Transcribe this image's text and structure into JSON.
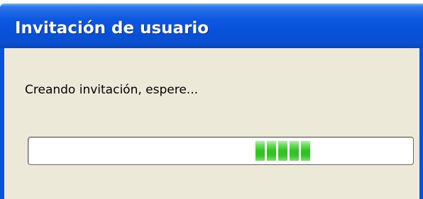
{
  "dialog": {
    "title": "Invitación de usuario",
    "message": "Creando invitación, espere...",
    "progress": {
      "type": "marquee",
      "block_count": 5,
      "position_fraction": 0.59,
      "color": "#2dc31f"
    }
  },
  "colors": {
    "titlebar": "#0852d8",
    "dialog_background": "#ece9d8",
    "progress_fill": "#2dc31f"
  }
}
